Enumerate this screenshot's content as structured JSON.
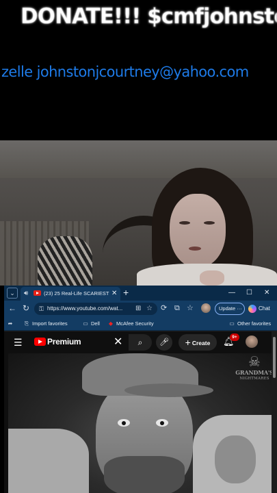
{
  "overlay": {
    "donate_text": "DONATE!!! $cmfjohnston",
    "zelle_text": "zelle johnstonjcourtney@yahoo.com"
  },
  "browser": {
    "tab": {
      "title": "(23) 25 Real-Life SCARIEST GI",
      "audio_icon": "speaker-icon",
      "close_glyph": "✕"
    },
    "new_tab_glyph": "+",
    "window_controls": {
      "minimize": "—",
      "maximize": "☐",
      "close": "✕"
    },
    "address_bar": {
      "url": "https://www.youtube.com/wat..."
    },
    "update_label": "Update",
    "update_more": "···",
    "chat_label": "Chat",
    "bookmarks": [
      {
        "label": "Import favorites"
      },
      {
        "label": "Dell"
      },
      {
        "label": "McAfee Security"
      }
    ],
    "other_favorites": "Other favorites"
  },
  "youtube": {
    "brand": "Premium",
    "create_label": "Create",
    "notification_count": "9+",
    "search_clear": "✕"
  },
  "video": {
    "watermark_line1": "GRANDMA'S",
    "watermark_line2": "NIGHTMARES"
  },
  "colors": {
    "zelle_text": "#1e7be8",
    "browser_chrome": "#133c63",
    "tab_strip": "#0a2a48",
    "youtube_red": "#ff0000",
    "youtube_bg": "#0f0f0f"
  }
}
